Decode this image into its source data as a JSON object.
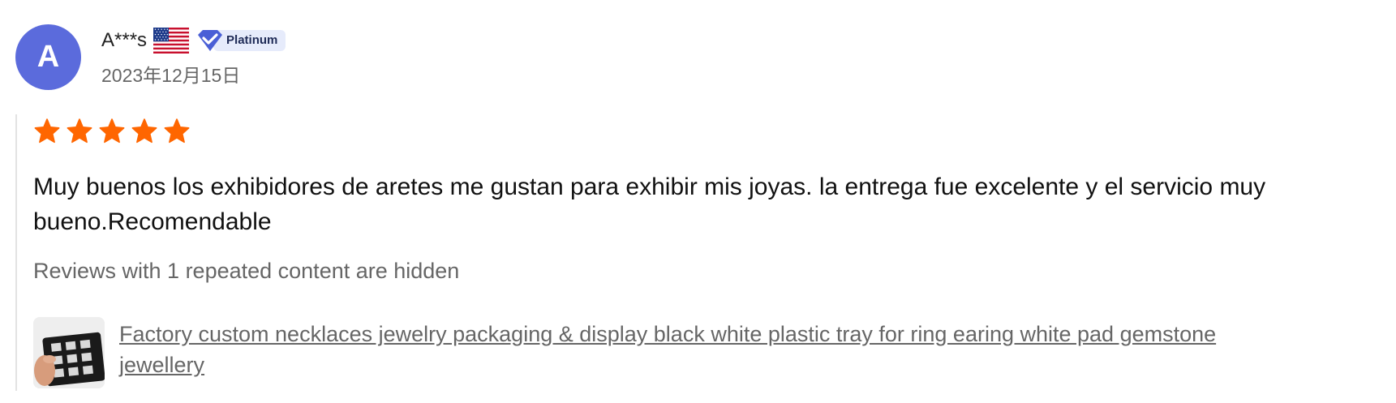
{
  "reviewer": {
    "avatar_letter": "A",
    "name": "A***s",
    "country_flag_icon": "us-flag-icon",
    "badge_label": "Platinum",
    "date": "2023年12月15日"
  },
  "rating": {
    "stars": 5,
    "max": 5
  },
  "review": {
    "text": "Muy buenos los exhibidores de aretes me gustan para exhibir mis joyas. la entrega fue excelente y el servicio muy bueno.Recomendable",
    "hidden_note": "Reviews with 1 repeated content are hidden"
  },
  "product": {
    "title": "Factory custom necklaces jewelry packaging & display black white plastic tray for ring earing white pad gemstone jewellery"
  },
  "colors": {
    "avatar": "#5b6bdc",
    "star": "#ff6600",
    "badge_icon": "#4a5fd6",
    "badge_bg": "#e6ebfb"
  }
}
